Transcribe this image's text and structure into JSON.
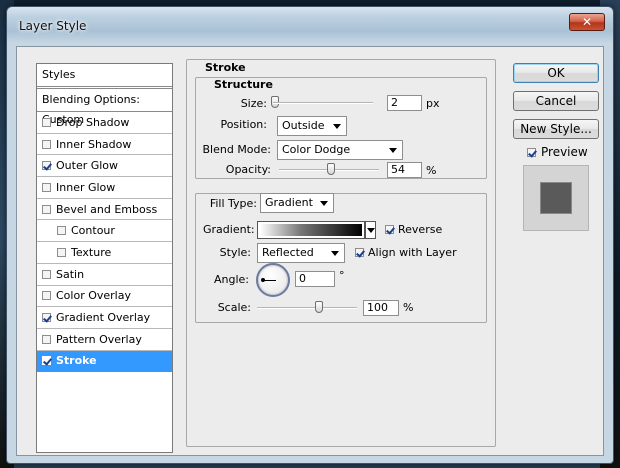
{
  "window": {
    "title": "Layer Style",
    "close_glyph": "✕"
  },
  "styles_list": {
    "header": "Styles",
    "blending": "Blending Options: Custom",
    "items": [
      {
        "label": "Drop Shadow",
        "checked": false,
        "indent": false,
        "selected": false
      },
      {
        "label": "Inner Shadow",
        "checked": false,
        "indent": false,
        "selected": false
      },
      {
        "label": "Outer Glow",
        "checked": true,
        "indent": false,
        "selected": false
      },
      {
        "label": "Inner Glow",
        "checked": false,
        "indent": false,
        "selected": false
      },
      {
        "label": "Bevel and Emboss",
        "checked": false,
        "indent": false,
        "selected": false
      },
      {
        "label": "Contour",
        "checked": false,
        "indent": true,
        "selected": false
      },
      {
        "label": "Texture",
        "checked": false,
        "indent": true,
        "selected": false
      },
      {
        "label": "Satin",
        "checked": false,
        "indent": false,
        "selected": false
      },
      {
        "label": "Color Overlay",
        "checked": false,
        "indent": false,
        "selected": false
      },
      {
        "label": "Gradient Overlay",
        "checked": true,
        "indent": false,
        "selected": false
      },
      {
        "label": "Pattern Overlay",
        "checked": false,
        "indent": false,
        "selected": false
      },
      {
        "label": "Stroke",
        "checked": true,
        "indent": false,
        "selected": true
      }
    ]
  },
  "stroke": {
    "title": "Stroke",
    "structure": {
      "title": "Structure",
      "size_label": "Size:",
      "size_value": "2",
      "size_unit": "px",
      "position_label": "Position:",
      "position_value": "Outside",
      "blend_label": "Blend Mode:",
      "blend_value": "Color Dodge",
      "opacity_label": "Opacity:",
      "opacity_value": "54",
      "opacity_unit": "%"
    },
    "fill": {
      "fill_type_label": "Fill Type:",
      "fill_type_value": "Gradient",
      "gradient_label": "Gradient:",
      "reverse_label": "Reverse",
      "reverse_checked": true,
      "style_label": "Style:",
      "style_value": "Reflected",
      "align_label": "Align with Layer",
      "align_checked": true,
      "angle_label": "Angle:",
      "angle_value": "0",
      "angle_unit": "°",
      "scale_label": "Scale:",
      "scale_value": "100",
      "scale_unit": "%"
    }
  },
  "buttons": {
    "ok": "OK",
    "cancel": "Cancel",
    "new_style": "New Style...",
    "preview": "Preview",
    "preview_checked": true
  },
  "colors": {
    "selected_row": "#3399ff",
    "preview_swatch": "#5a5a5a"
  }
}
